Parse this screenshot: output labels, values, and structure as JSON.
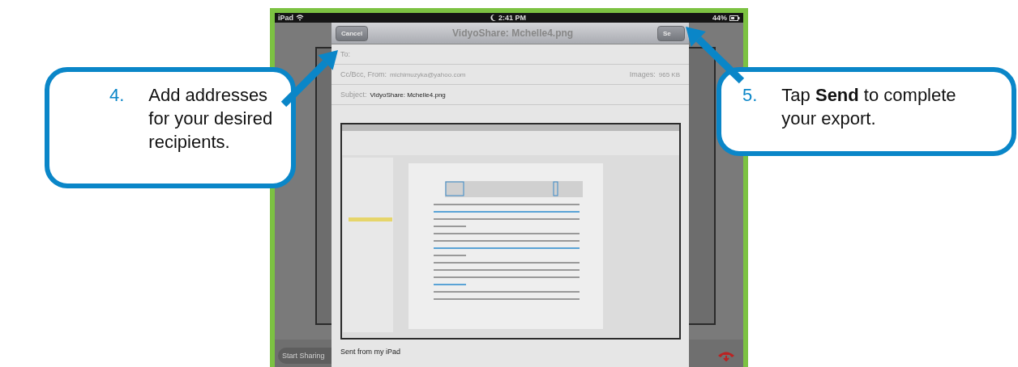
{
  "callouts": [
    {
      "number": "4.",
      "text": "Add addresses for your desired recipients."
    },
    {
      "number": "5.",
      "text": "Tap **Send** to complete your export."
    }
  ],
  "status_bar": {
    "device": "iPad",
    "time": "2:41 PM",
    "battery": "44%"
  },
  "mail": {
    "cancel": "Cancel",
    "title": "VidyoShare: Mchelle4.png",
    "send": "Se",
    "to_label": "To:",
    "cc_label": "Cc/Bcc, From:",
    "from": "michimuzyka@yahoo.com",
    "images_label": "Images:",
    "images_size": "965 KB",
    "subject_label": "Subject:",
    "subject": "VidyoShare: Mchelle4.png",
    "signature": "Sent from my iPad"
  },
  "background": {
    "start_sharing": "Start Sharing"
  }
}
